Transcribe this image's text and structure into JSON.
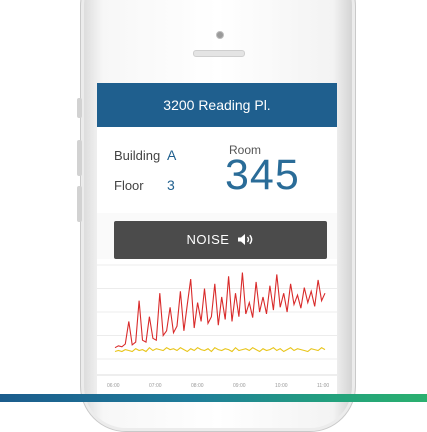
{
  "header": {
    "title": "3200 Reading Pl."
  },
  "details": {
    "building_label": "Building",
    "building_value": "A",
    "floor_label": "Floor",
    "floor_value": "3",
    "room_label": "Room",
    "room_value": "345"
  },
  "noise_button": {
    "label": "NOISE",
    "icon": "speaker-icon"
  },
  "colors": {
    "accent": "#1f5f8e",
    "noise_red": "#d92b2b",
    "noise_yellow": "#e8c51a",
    "button_dark": "#4b4b4b"
  },
  "chart_data": {
    "type": "line",
    "title": "",
    "xlabel": "",
    "ylabel": "",
    "x_ticks": [
      "06:00",
      "07:00",
      "08:00",
      "09:00",
      "10:00",
      "11:00"
    ],
    "ylim": [
      0,
      100
    ],
    "grid": true,
    "series": [
      {
        "values": [
          12,
          14,
          13,
          16,
          40,
          15,
          18,
          62,
          20,
          18,
          45,
          22,
          20,
          70,
          25,
          30,
          55,
          28,
          35,
          72,
          30,
          58,
          85,
          33,
          60,
          40,
          75,
          38,
          45,
          80,
          36,
          66,
          42,
          88,
          40,
          70,
          45,
          92,
          48,
          60,
          44,
          82,
          50,
          66,
          48,
          78,
          52,
          90,
          55,
          70,
          50,
          80,
          58,
          68,
          54,
          76,
          60,
          72,
          56,
          84,
          62,
          70
        ]
      },
      {
        "values": [
          8,
          9,
          8,
          10,
          9,
          8,
          11,
          9,
          10,
          8,
          12,
          9,
          11,
          10,
          9,
          12,
          10,
          11,
          9,
          12,
          10,
          8,
          11,
          9,
          12,
          10,
          9,
          11,
          8,
          12,
          10,
          9,
          11,
          10,
          8,
          12,
          9,
          10,
          11,
          9,
          12,
          10,
          8,
          11,
          9,
          10,
          12,
          9,
          11,
          8,
          10,
          12,
          9,
          11,
          10,
          9,
          8,
          11,
          10,
          9,
          12,
          10
        ]
      }
    ]
  }
}
